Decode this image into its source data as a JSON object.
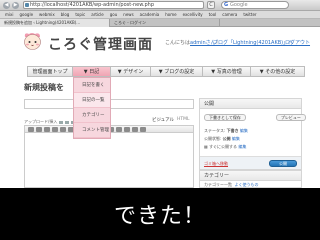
{
  "browser": {
    "url": "http://localhost/4201AKB/wp-admin/post-new.php",
    "reload_label": "C",
    "search_placeholder": "Google",
    "bookmarks": [
      "mixi",
      "google",
      "webmix",
      "blog",
      "topic",
      "article",
      "gou",
      "news",
      "academia",
      "home",
      "excellivity",
      "tool",
      "camera",
      "twitter"
    ],
    "tabs": [
      {
        "label": "新規投稿を追加 ‹ Lightning(4201AKB)…",
        "active": true
      },
      {
        "label": "ころぐ - ログイン",
        "active": false
      }
    ]
  },
  "header": {
    "logo": "ころぐ管理画面",
    "greeting_prefix": "こんにちは",
    "user": "adminさん",
    "greeting_suffix": "！",
    "mypage": "ブログ「Lightning(4201AKB)」へ",
    "logout": "ログアウト"
  },
  "menu": {
    "items": [
      {
        "label": "管理画面トップ",
        "active": false
      },
      {
        "label": "▼ 日記",
        "active": true
      },
      {
        "label": "▼ デザイン",
        "active": false
      },
      {
        "label": "▼ ブログの設定",
        "active": false
      },
      {
        "label": "▼ 写真の管理",
        "active": false
      },
      {
        "label": "▼ その他の設定",
        "active": false
      }
    ],
    "dropdown": [
      "日記を書く",
      "日記の一覧",
      "カテゴリー",
      "コメント管理"
    ]
  },
  "post": {
    "heading": "新規投稿を",
    "upload_label": "アップロード/挿入",
    "tab_visual": "ビジュアル",
    "tab_html": "HTML"
  },
  "publish_box": {
    "title": "公開",
    "save_draft": "下書きとして保存",
    "preview": "プレビュー",
    "status_label": "ステータス: ",
    "status_value": "下書き",
    "status_edit": "編集",
    "visibility_label": "公開状態: ",
    "visibility_value": "公開",
    "visibility_edit": "編集",
    "schedule_label": "すぐに公開する",
    "schedule_edit": "編集",
    "trash": "ゴミ箱へ移動",
    "publish": "公開"
  },
  "category_box": {
    "title": "カテゴリー",
    "all_label": "カテゴリー一覧",
    "popular_label": "よく使うもの"
  },
  "caption": "できた！"
}
